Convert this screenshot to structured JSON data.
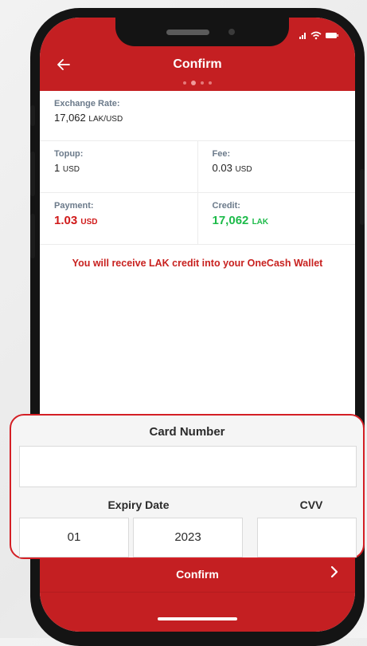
{
  "header": {
    "title": "Confirm",
    "back_icon": "arrow-left-icon"
  },
  "details": {
    "exchange_rate": {
      "label": "Exchange Rate:",
      "value": "17,062",
      "unit": "LAK/USD"
    },
    "topup": {
      "label": "Topup:",
      "value": "1",
      "unit": "USD"
    },
    "fee": {
      "label": "Fee:",
      "value": "0.03",
      "unit": "USD"
    },
    "payment": {
      "label": "Payment:",
      "value": "1.03",
      "unit": "USD"
    },
    "credit": {
      "label": "Credit:",
      "value": "17,062",
      "unit": "LAK"
    },
    "notice": "You will receive LAK credit into your OneCash Wallet"
  },
  "card_form": {
    "card_number_label": "Card Number",
    "card_number_value": "",
    "expiry_label": "Expiry Date",
    "expiry_month": "01",
    "expiry_year": "2023",
    "cvv_label": "CVV",
    "cvv_value": ""
  },
  "footer": {
    "confirm_label": "Confirm",
    "chevron_icon": "chevron-right-icon"
  },
  "colors": {
    "brand_red": "#c41f22",
    "payment_red": "#d01a1a",
    "credit_green": "#1dbb4a",
    "notice_red": "#c8211f"
  }
}
